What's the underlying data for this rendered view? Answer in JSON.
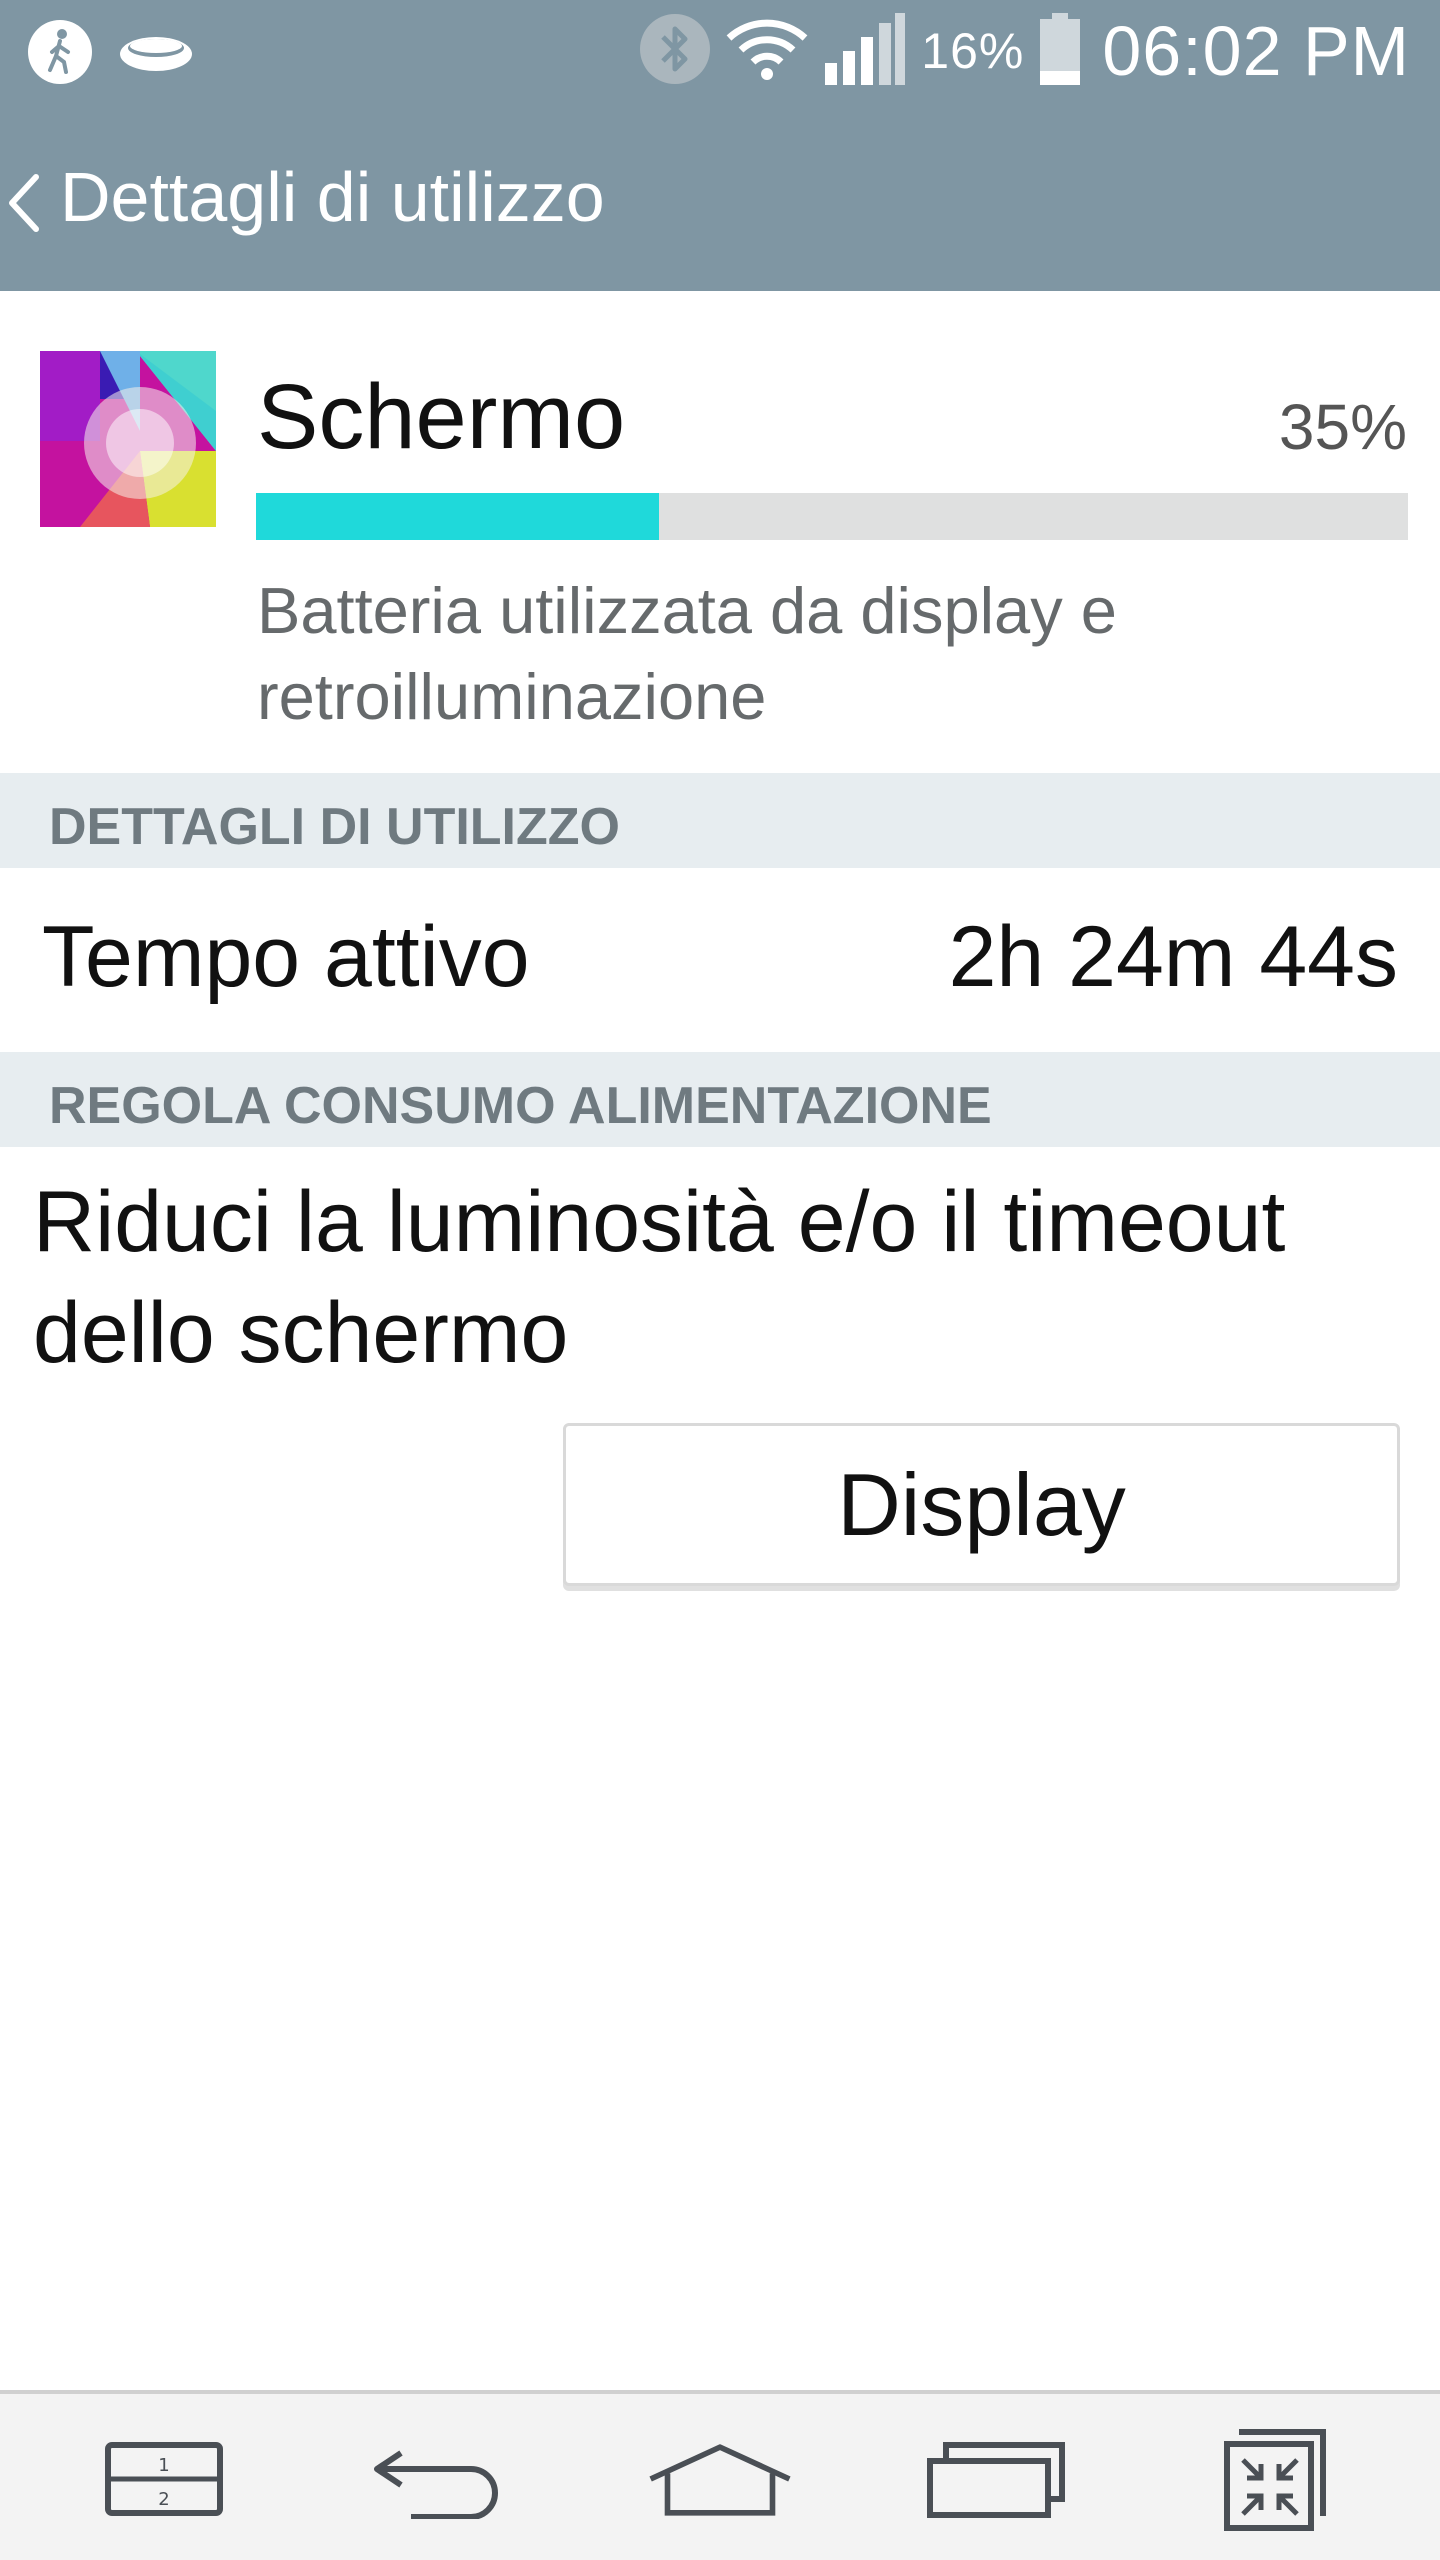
{
  "status_bar": {
    "left_icons": [
      "pedometer-icon",
      "ring-icon"
    ],
    "right_icons": [
      "bluetooth-icon",
      "wifi-icon",
      "signal-icon",
      "battery-icon"
    ],
    "battery_percent": "16%",
    "time": "06:02 PM"
  },
  "header": {
    "back_icon": "chevron-left-icon",
    "title": "Dettagli di utilizzo"
  },
  "app": {
    "name": "Schermo",
    "usage_percent_label": "35%",
    "usage_fraction": 0.35,
    "description": "Batteria utilizzata da display e retroilluminazione"
  },
  "sections": {
    "usage_details": {
      "title": "DETTAGLI DI UTILIZZO",
      "rows": [
        {
          "label": "Tempo attivo",
          "value": "2h 24m 44s"
        }
      ]
    },
    "power_adjust": {
      "title": "REGOLA CONSUMO ALIMENTAZIONE",
      "suggestion": "Riduci la luminosità e/o il timeout dello schermo",
      "button_label": "Display"
    }
  },
  "nav_bar": {
    "buttons": [
      "dual-window-icon",
      "back-icon",
      "home-icon",
      "recent-apps-icon",
      "mini-view-icon"
    ]
  },
  "colors": {
    "header_bg": "#7f96a3",
    "section_bg": "#e7edf0",
    "bar_fill": "#1fd9da",
    "bar_track": "#dfe0e0"
  }
}
